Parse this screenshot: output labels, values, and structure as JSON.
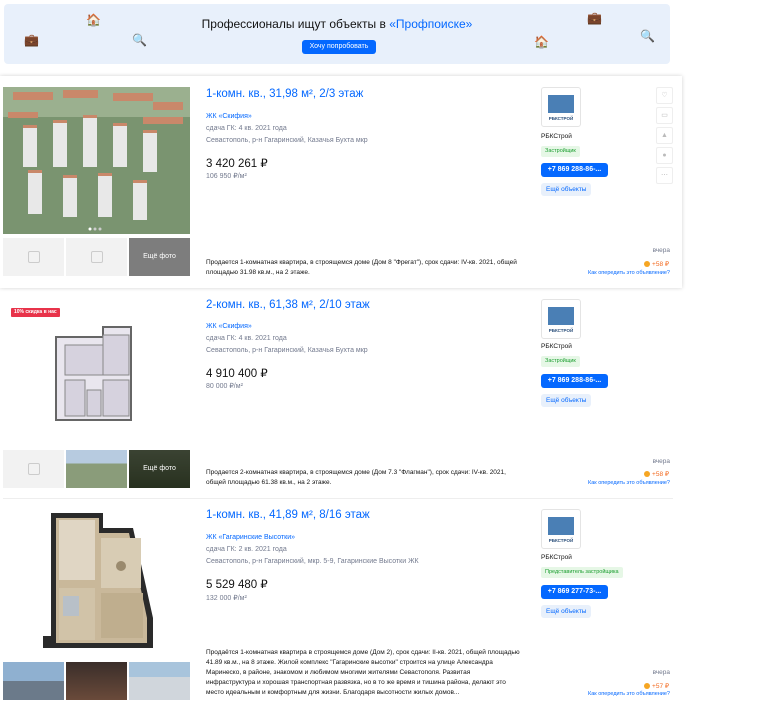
{
  "banner": {
    "title_prefix": "Профессионалы ищут объекты в ",
    "title_highlight": "«Профпоиске»",
    "button_label": "Хочу попробовать"
  },
  "listings": [
    {
      "title": "1-комн. кв., 31,98 м², 2/3 этаж",
      "complex": "ЖК «Скифия»",
      "deadline": "сдача ГК: 4 кв. 2021 года",
      "address": "Севастополь, р-н Гагаринский, Казачья Бухта мкр",
      "price": "3 420 261 ₽",
      "price_per_sqm": "106 950 ₽/м²",
      "description": "Продается 1-комнатная квартира, в строящемся доме (Дом 8 \"Фрегат\"), срок сдачи: IV-кв. 2021, общей площадью 31.98 кв.м., на 2 этаже.",
      "more_photos_label": "Ещё фото",
      "agent_name": "РБКСтрой",
      "agent_badge": "Застройщик",
      "phone": "+7 869 288-86-...",
      "objects_button": "Ещё объекты",
      "date": "вчера",
      "auction": "+58 ₽",
      "howto": "Как опередить это объявление?",
      "logo_text": "РБКСТРОЙ"
    },
    {
      "title": "2-комн. кв., 61,38 м², 2/10 этаж",
      "complex": "ЖК «Скифия»",
      "deadline": "сдача ГК: 4 кв. 2021 года",
      "address": "Севастополь, р-н Гагаринский, Казачья Бухта мкр",
      "price": "4 910 400 ₽",
      "price_per_sqm": "80 000 ₽/м²",
      "description": "Продается 2-комнатная квартира, в строящемся доме (Дом 7.3 \"Флагман\"), срок сдачи: IV-кв. 2021, общей площадью 61.38 кв.м., на 2 этаже.",
      "more_photos_label": "Ещё фото",
      "discount": "10% скидка в нас",
      "agent_name": "РБКСтрой",
      "agent_badge": "Застройщик",
      "phone": "+7 869 288-86-...",
      "objects_button": "Ещё объекты",
      "date": "вчера",
      "auction": "+58 ₽",
      "howto": "Как опередить это объявление?",
      "logo_text": "РБКСТРОЙ"
    },
    {
      "title": "1-комн. кв., 41,89 м², 8/16 этаж",
      "complex": "ЖК «Гагаринские Высотки»",
      "deadline": "сдача ГК: 2 кв. 2021 года",
      "address": "Севастополь, р-н Гагаринский, мкр. 5-9, Гагаринские Высотки ЖК",
      "price": "5 529 480 ₽",
      "price_per_sqm": "132 000 ₽/м²",
      "description": "Продаётся 1-комнатная квартира в строящемся доме (Дом 2), срок сдачи: II-кв. 2021, общей площадью 41.89 кв.м., на 8 этаже. Жилой комплекс \"Гагаринские высотки\" строится на улице Александра Маринеско, в районе, знакомом и любимом многими жителями Севастополя. Развитая инфраструктура и хорошая транспортная развязка, но в то же время и тишина района, делают это место идеальным и комфортным для жизни. Благодаря высотности жилых домов...",
      "agent_name": "РБКСтрой",
      "agent_badge": "Представитель застройщика",
      "phone": "+7 869 277-73-...",
      "objects_button": "Ещё объекты",
      "date": "вчера",
      "auction": "+57 ₽",
      "howto": "Как опередить это объявление?",
      "logo_text": "РБКСТРОЙ"
    }
  ],
  "icons": [
    "heart-icon",
    "note-icon",
    "compare-icon",
    "pin-icon",
    "more-icon"
  ],
  "colors": {
    "link": "#0468ff",
    "accent": "#f36b21",
    "badge_green": "#1a9e2f",
    "banner_bg": "#e8f0fb"
  }
}
